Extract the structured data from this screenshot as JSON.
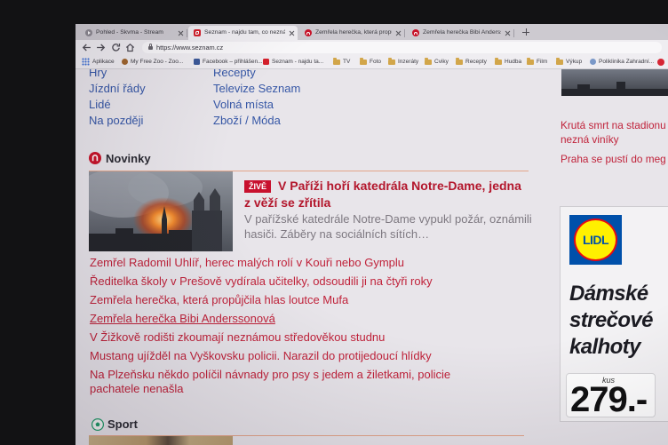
{
  "browser": {
    "tabs": [
      {
        "title": "Pohled - Skvma - Stream",
        "favicon": "stream-favicon"
      },
      {
        "title": "Seznam - najdu tam, co neznám",
        "favicon": "seznam-favicon"
      },
      {
        "title": "Zemřela herečka, která propůjčila",
        "favicon": "novinky-favicon"
      },
      {
        "title": "Zemřela herečka Bibi Anderssonová",
        "favicon": "novinky-favicon"
      }
    ],
    "active_tab_index": 1,
    "url": "https://www.seznam.cz",
    "toolbar_icons": [
      "back-arrow-icon",
      "forward-arrow-icon",
      "reload-icon",
      "home-icon",
      "lock-icon"
    ],
    "bookmarks": [
      {
        "label": "Aplikace",
        "icon": "apps-grid-icon"
      },
      {
        "label": "My Free Zoo - Zoo...",
        "icon": "zoo-favicon"
      },
      {
        "label": "Facebook – přihlášen...",
        "icon": "facebook-favicon"
      },
      {
        "label": "Seznam - najdu ta...",
        "icon": "seznam-favicon"
      },
      {
        "label": "TV",
        "icon": "folder-icon"
      },
      {
        "label": "Foto",
        "icon": "folder-icon"
      },
      {
        "label": "Inzeráty",
        "icon": "folder-icon"
      },
      {
        "label": "Cviky",
        "icon": "folder-icon"
      },
      {
        "label": "Recepty",
        "icon": "folder-icon"
      },
      {
        "label": "Hudba",
        "icon": "folder-icon"
      },
      {
        "label": "Film",
        "icon": "folder-icon"
      },
      {
        "label": "Výkup",
        "icon": "folder-icon"
      },
      {
        "label": "Poliklinika Zahradní...",
        "icon": "globe-favicon"
      }
    ]
  },
  "services": {
    "column_1": [
      "Hry",
      "Jízdní řády",
      "Lidé",
      "Na později"
    ],
    "column_2": [
      "Recepty",
      "Televize Seznam",
      "Volná místa",
      "Zboží / Móda"
    ]
  },
  "sidebar": {
    "headlines": [
      "Krutá smrt na stadionu nezná viníky",
      "Praha se pustí do meg"
    ]
  },
  "ad": {
    "logo_text": "LIDL",
    "headline_lines": [
      "Dámské",
      "strečové",
      "kalhoty"
    ],
    "unit": "kus",
    "price": "279.-"
  },
  "novinky": {
    "title": "Novinky",
    "icon": "novinky-logo-icon",
    "featured": {
      "badge": "ŽIVĚ",
      "headline": "V Paříži hoří katedrála Notre-Dame, jedna z věží se zřítila",
      "perex": "V pařížské katedrále Notre-Dame vypukl požár, oznámili hasiči. Záběry na sociálních sítích…"
    },
    "articles": [
      "Zemřel Radomil Uhlíř, herec malých rolí v Kouři nebo Gymplu",
      "Ředitelka školy v Prešově vydírala učitelky, odsoudili ji na čtyři roky",
      "Zemřela herečka, která propůjčila hlas loutce Mufa",
      "Zemřela herečka Bibi Anderssonová",
      "V Žižkově rodišti zkoumají neznámou středověkou studnu",
      "Mustang ujížděl na Vyškovsku policii. Narazil do protijedoucí hlídky",
      "Na Plzeňsku někdo políčil návnady pro psy s jedem a žiletkami, policie pachatele nenašla"
    ],
    "hovered_article_index": 3
  },
  "sport": {
    "title": "Sport",
    "icon": "football-icon"
  },
  "colors": {
    "link_blue": "#3657a6",
    "article_red": "#c0223a",
    "headline_red": "#b3162c",
    "badge_red": "#c8102e",
    "separator_orange": "#e3a58a",
    "lidl_blue": "#0050aa",
    "lidl_yellow": "#fff000",
    "lidl_red": "#e60a14"
  }
}
